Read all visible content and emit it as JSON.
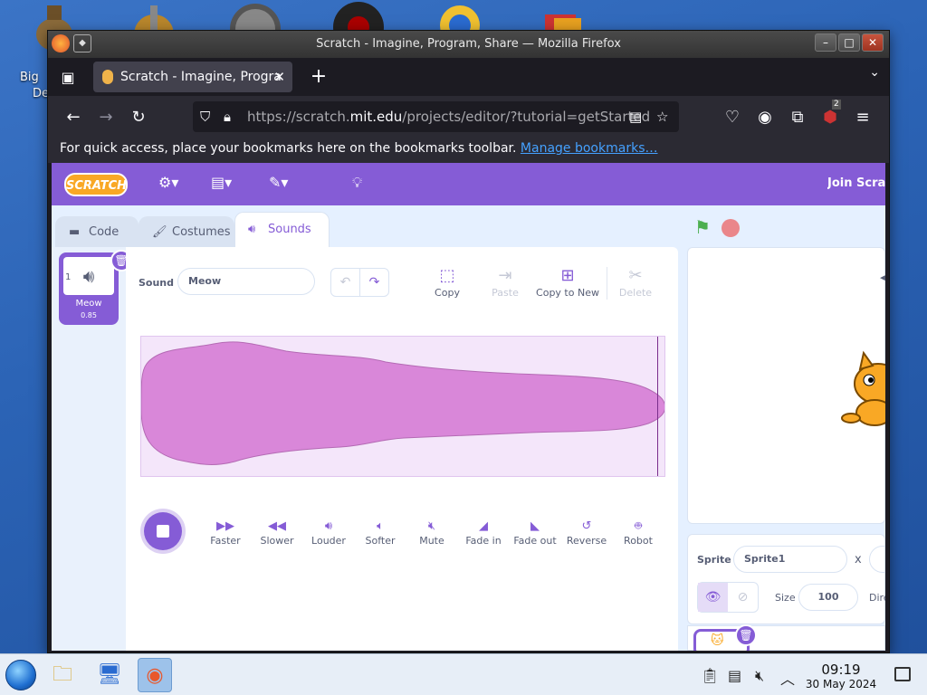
{
  "desktop": {
    "icon_label_line1": "Big",
    "icon_label_line2": "De"
  },
  "window": {
    "title": "Scratch - Imagine, Program, Share — Mozilla Firefox"
  },
  "browser": {
    "tab_title": "Scratch - Imagine, Progra",
    "url_prefix": "https://scratch.",
    "url_domain": "mit.edu",
    "url_rest": "/projects/editor/?tutorial=getStarted",
    "extensions_badge": "2",
    "bookmarks_message": "For quick access, place your bookmarks here on the bookmarks toolbar.",
    "bookmarks_link": "Manage bookmarks…"
  },
  "scratch": {
    "logo": "SCRATCH",
    "join_label": "Join Scratch",
    "tabs": [
      {
        "label": "Code"
      },
      {
        "label": "Costumes"
      },
      {
        "label": "Sounds"
      }
    ],
    "sound_list": [
      {
        "index": "1",
        "name": "Meow",
        "duration": "0.85"
      }
    ],
    "sound_label": "Sound",
    "sound_name": "Meow",
    "actions": {
      "copy": "Copy",
      "paste": "Paste",
      "copy_to_new": "Copy to New",
      "delete": "Delete"
    },
    "effects": [
      {
        "label": "Faster",
        "icon": "faster-icon"
      },
      {
        "label": "Slower",
        "icon": "slower-icon"
      },
      {
        "label": "Louder",
        "icon": "louder-icon"
      },
      {
        "label": "Softer",
        "icon": "softer-icon"
      },
      {
        "label": "Mute",
        "icon": "mute-icon"
      },
      {
        "label": "Fade in",
        "icon": "fade-in-icon"
      },
      {
        "label": "Fade out",
        "icon": "fade-out-icon"
      },
      {
        "label": "Reverse",
        "icon": "reverse-icon"
      },
      {
        "label": "Robot",
        "icon": "robot-icon"
      }
    ],
    "sprite_info": {
      "sprite_label": "Sprite",
      "sprite_name": "Sprite1",
      "x_label": "x",
      "size_label": "Size",
      "size_value": "100",
      "direction_label": "Dire"
    }
  },
  "taskbar": {
    "time": "09:19",
    "date": "30 May 2024"
  },
  "colors": {
    "scratch_purple": "#855cd6",
    "waveform_fill": "#d987d9",
    "firefox_dark": "#1c1b22"
  }
}
